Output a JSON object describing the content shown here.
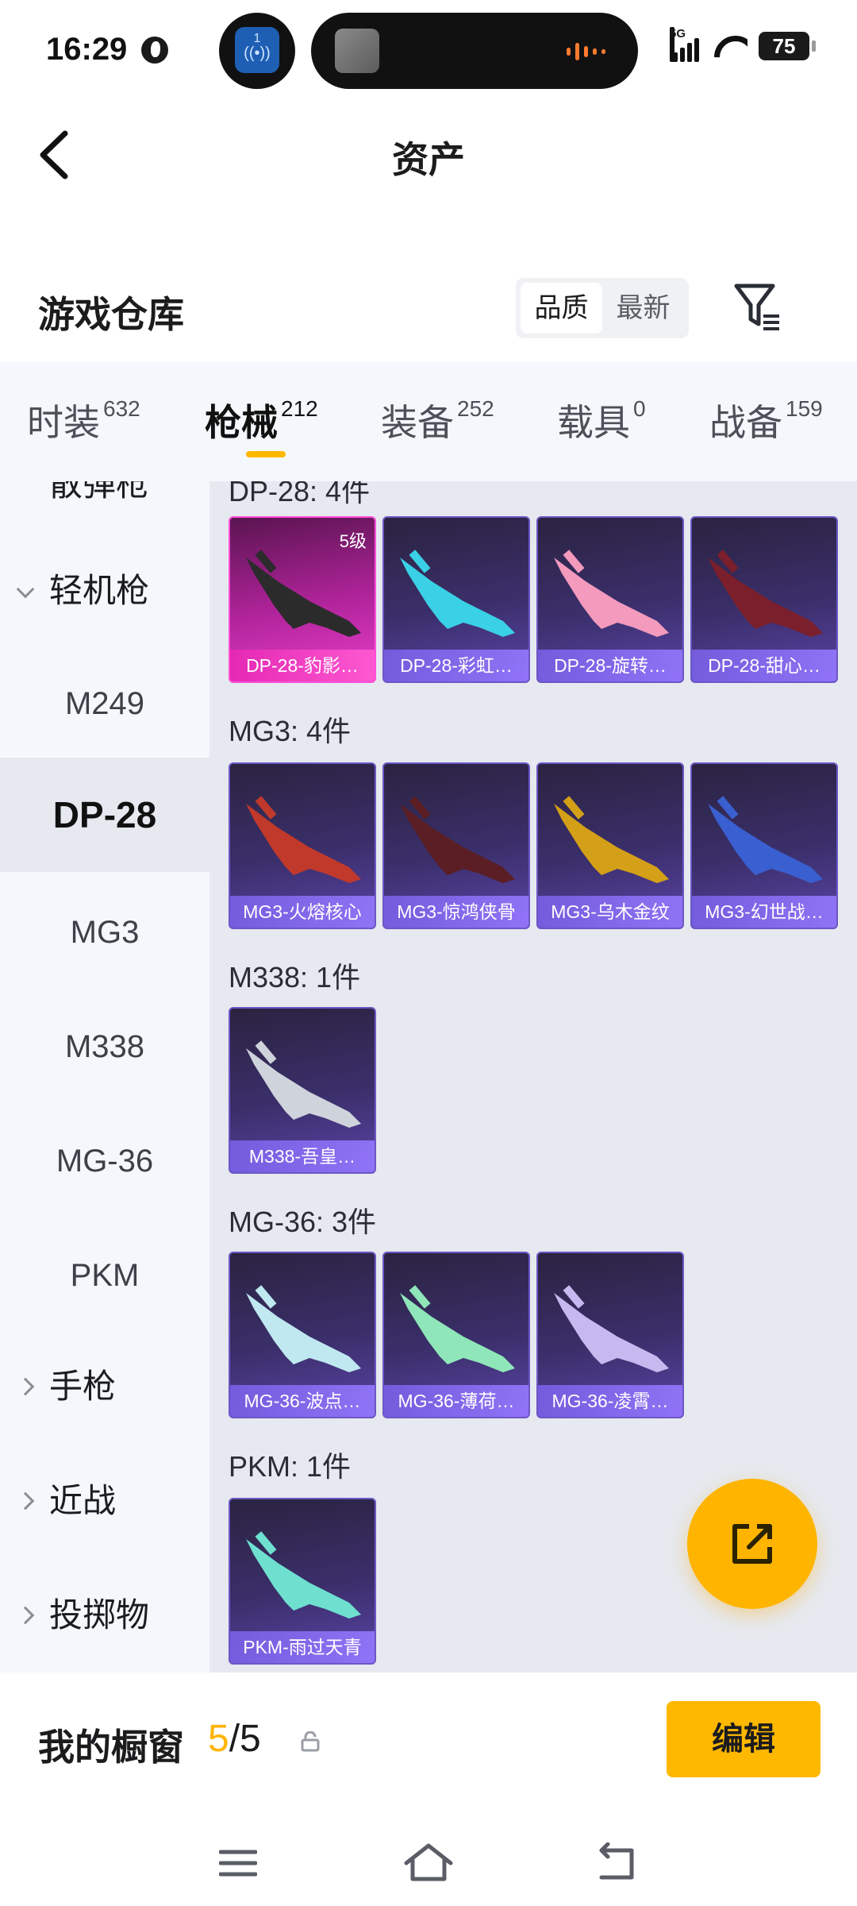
{
  "status_bar": {
    "time": "16:29",
    "notif_badge": "1",
    "network": "5G",
    "battery": "75"
  },
  "header": {
    "title": "资产"
  },
  "warehouse": {
    "title": "游戏仓库",
    "sort_options": [
      "品质",
      "最新"
    ],
    "active_sort": "品质"
  },
  "tabs": [
    {
      "label": "时装",
      "count": "632"
    },
    {
      "label": "枪械",
      "count": "212",
      "active": true
    },
    {
      "label": "装备",
      "count": "252"
    },
    {
      "label": "载具",
      "count": "0"
    },
    {
      "label": "战备",
      "count": "159"
    }
  ],
  "sidebar": {
    "cut_top_label": "散弹枪",
    "categories": [
      {
        "label": "轻机枪",
        "expanded": true
      },
      {
        "label": "手枪",
        "expanded": false
      },
      {
        "label": "近战",
        "expanded": false
      },
      {
        "label": "投掷物",
        "expanded": false
      }
    ],
    "sub_items": [
      "M249",
      "DP-28",
      "MG3",
      "M338",
      "MG-36",
      "PKM"
    ],
    "active_sub": "DP-28"
  },
  "groups": [
    {
      "title": "DP-28: 4件",
      "items": [
        {
          "label": "DP-28-豹影…",
          "level": "5级",
          "rarity": "pink"
        },
        {
          "label": "DP-28-彩虹…"
        },
        {
          "label": "DP-28-旋转…"
        },
        {
          "label": "DP-28-甜心…"
        }
      ]
    },
    {
      "title": "MG3: 4件",
      "items": [
        {
          "label": "MG3-火熔核心"
        },
        {
          "label": "MG3-惊鸿侠骨"
        },
        {
          "label": "MG3-乌木金纹"
        },
        {
          "label": "MG3-幻世战…"
        }
      ]
    },
    {
      "title": "M338: 1件",
      "items": [
        {
          "label": "M338-吾皇…"
        }
      ]
    },
    {
      "title": "MG-36: 3件",
      "items": [
        {
          "label": "MG-36-波点…"
        },
        {
          "label": "MG-36-薄荷…"
        },
        {
          "label": "MG-36-凌霄…"
        }
      ]
    },
    {
      "title": "PKM: 1件",
      "items": [
        {
          "label": "PKM-雨过天青"
        }
      ]
    }
  ],
  "showcase": {
    "label": "我的橱窗",
    "current": "5",
    "separator": "/",
    "total": "5",
    "edit_label": "编辑"
  },
  "icons": {
    "back": "chevron-left-icon",
    "filter": "filter-icon",
    "fab": "share-external-icon",
    "lock": "lock-icon"
  },
  "colors": {
    "accent": "#ffb800",
    "card_purple": "#3b2f6b",
    "card_pink": "#e83fc8"
  }
}
